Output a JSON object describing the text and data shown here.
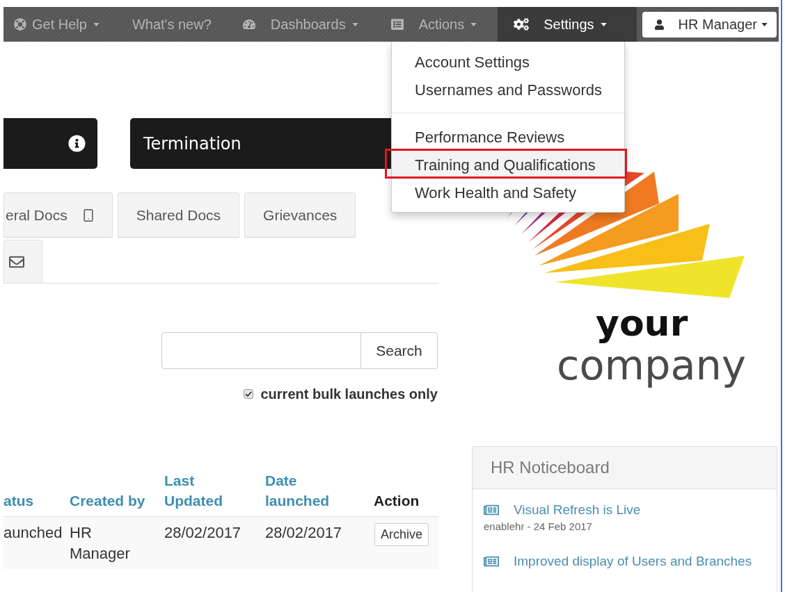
{
  "top_nav": {
    "items": [
      {
        "label": "Get Help",
        "dropdown": true,
        "selected": false
      },
      {
        "label": "What's new?",
        "dropdown": false,
        "selected": false
      },
      {
        "label": "Dashboards",
        "dropdown": true,
        "selected": false
      },
      {
        "label": "Actions",
        "dropdown": true,
        "selected": false
      },
      {
        "label": "Settings",
        "dropdown": true,
        "selected": true
      }
    ],
    "user_menu": {
      "label": "HR Manager"
    }
  },
  "settings_menu": {
    "sections": [
      {
        "items": [
          {
            "label": "Account Settings",
            "highlighted": false,
            "outlined": false
          },
          {
            "label": "Usernames and Passwords",
            "highlighted": false,
            "outlined": false
          }
        ]
      },
      {
        "items": [
          {
            "label": "Performance Reviews",
            "highlighted": false,
            "outlined": false
          },
          {
            "label": "Training and Qualifications",
            "highlighted": true,
            "outlined": true
          },
          {
            "label": "Work Health and Safety",
            "highlighted": false,
            "outlined": false
          }
        ]
      }
    ]
  },
  "tiles": [
    {
      "kind": "info"
    },
    {
      "kind": "title",
      "title": "Termination"
    }
  ],
  "tab_rows": [
    {
      "tabs": [
        {
          "kind": "text_icon",
          "label": "eral Docs",
          "selected": false
        },
        {
          "kind": "text",
          "label": "Shared Docs",
          "selected": false
        },
        {
          "kind": "text",
          "label": "Grievances",
          "selected": false
        }
      ]
    },
    {
      "tabs": [
        {
          "kind": "icon",
          "selected": true
        }
      ]
    }
  ],
  "search": {
    "button": "Search"
  },
  "filter": {
    "label": "current bulk launches only",
    "checked": true
  },
  "table": {
    "columns": [
      {
        "label": "atus",
        "linked": true
      },
      {
        "label": "Created by",
        "linked": true
      },
      {
        "label": "Last Updated",
        "linked": true
      },
      {
        "label": "Date launched",
        "linked": true
      },
      {
        "label": "Action",
        "linked": false
      }
    ],
    "rows": [
      {
        "cells": [
          "aunched",
          "HR Manager",
          "28/02/2017",
          "28/02/2017"
        ],
        "action": "Archive"
      }
    ]
  },
  "logo": {
    "line_1": "your",
    "line_2": "company"
  },
  "noticeboard": {
    "title": "HR Noticeboard",
    "posts": [
      {
        "title": "Visual Refresh is Live",
        "meta": "enablehr - 24 Feb 2017"
      },
      {
        "title": "Improved display of Users and Branches"
      }
    ]
  }
}
